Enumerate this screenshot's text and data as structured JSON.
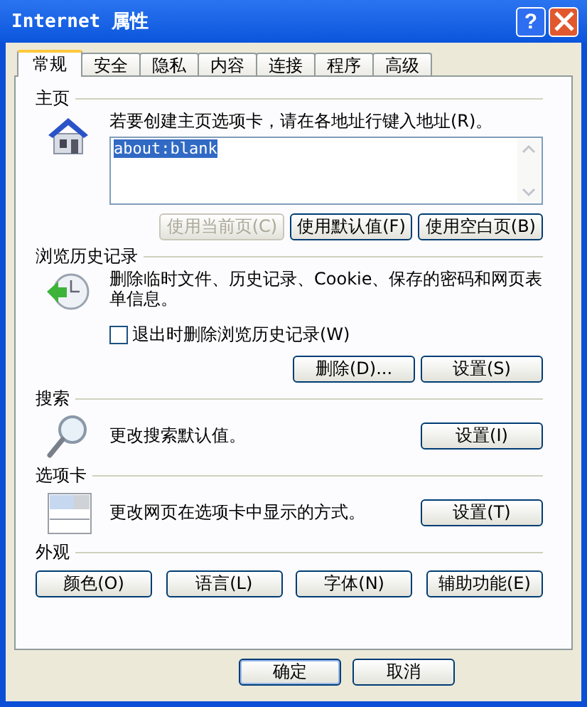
{
  "window": {
    "title": "Internet 属性",
    "help_label": "?"
  },
  "tabs": [
    {
      "label": "常规",
      "selected": true
    },
    {
      "label": "安全",
      "selected": false
    },
    {
      "label": "隐私",
      "selected": false
    },
    {
      "label": "内容",
      "selected": false
    },
    {
      "label": "连接",
      "selected": false
    },
    {
      "label": "程序",
      "selected": false
    },
    {
      "label": "高级",
      "selected": false
    }
  ],
  "home_page": {
    "heading": "主页",
    "description": "若要创建主页选项卡，请在各地址行键入地址(R)。",
    "address": "about:blank",
    "buttons": [
      {
        "label": "使用当前页(C)",
        "disabled": true
      },
      {
        "label": "使用默认值(F)",
        "disabled": false
      },
      {
        "label": "使用空白页(B)",
        "disabled": false
      }
    ]
  },
  "browsing_history": {
    "heading": "浏览历史记录",
    "description": "删除临时文件、历史记录、Cookie、保存的密码和网页表单信息。",
    "checkbox": {
      "label": "退出时删除浏览历史记录(W)",
      "checked": false
    },
    "buttons": [
      "删除(D)...",
      "设置(S)"
    ]
  },
  "search": {
    "heading": "搜索",
    "description": "更改搜索默认值。",
    "button": "设置(I)"
  },
  "tabs_section": {
    "heading": "选项卡",
    "description": "更改网页在选项卡中显示的方式。",
    "button": "设置(T)"
  },
  "appearance": {
    "heading": "外观",
    "buttons": [
      "颜色(O)",
      "语言(L)",
      "字体(N)",
      "辅助功能(E)"
    ]
  },
  "footer_buttons": [
    "确定",
    "取消"
  ]
}
